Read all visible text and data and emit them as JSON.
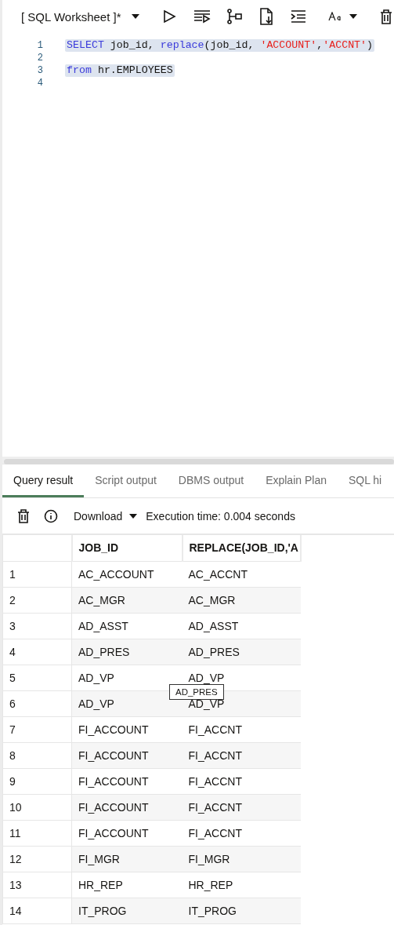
{
  "worksheet": {
    "title": "[ SQL Worksheet ]*"
  },
  "editor": {
    "lines": [
      {
        "number": "1",
        "highlighted": true,
        "tokens": [
          {
            "text": "SELECT",
            "kind": "keyword"
          },
          {
            "text": " job_id, ",
            "kind": "plain"
          },
          {
            "text": "replace",
            "kind": "keyword"
          },
          {
            "text": "(job_id, ",
            "kind": "plain"
          },
          {
            "text": "'ACCOUNT'",
            "kind": "string"
          },
          {
            "text": ",",
            "kind": "plain"
          },
          {
            "text": "'ACCNT'",
            "kind": "string"
          },
          {
            "text": ")",
            "kind": "plain"
          }
        ]
      },
      {
        "number": "2"
      },
      {
        "number": "3",
        "highlighted": true,
        "tokens": [
          {
            "text": "from",
            "kind": "keyword"
          },
          {
            "text": " hr.EMPLOYEES",
            "kind": "plain"
          }
        ]
      },
      {
        "number": "4"
      }
    ]
  },
  "tabs": [
    {
      "label": "Query result",
      "selected": true
    },
    {
      "label": "Script output",
      "selected": false
    },
    {
      "label": "DBMS output",
      "selected": false
    },
    {
      "label": "Explain Plan",
      "selected": false
    },
    {
      "label": "SQL hi",
      "selected": false
    }
  ],
  "result_toolbar": {
    "download": "Download",
    "execution_time": "Execution time: 0.004 seconds"
  },
  "table": {
    "columns": [
      "",
      "JOB_ID",
      "REPLACE(JOB_ID,'A"
    ],
    "rows": [
      [
        "1",
        "AC_ACCOUNT",
        "AC_ACCNT"
      ],
      [
        "2",
        "AC_MGR",
        "AC_MGR"
      ],
      [
        "3",
        "AD_ASST",
        "AD_ASST"
      ],
      [
        "4",
        "AD_PRES",
        "AD_PRES"
      ],
      [
        "5",
        "AD_VP",
        "AD_VP"
      ],
      [
        "6",
        "AD_VP",
        "AD_VP"
      ],
      [
        "7",
        "FI_ACCOUNT",
        "FI_ACCNT"
      ],
      [
        "8",
        "FI_ACCOUNT",
        "FI_ACCNT"
      ],
      [
        "9",
        "FI_ACCOUNT",
        "FI_ACCNT"
      ],
      [
        "10",
        "FI_ACCOUNT",
        "FI_ACCNT"
      ],
      [
        "11",
        "FI_ACCOUNT",
        "FI_ACCNT"
      ],
      [
        "12",
        "FI_MGR",
        "FI_MGR"
      ],
      [
        "13",
        "HR_REP",
        "HR_REP"
      ],
      [
        "14",
        "IT_PROG",
        "IT_PROG"
      ]
    ]
  },
  "tooltip": {
    "text": "AD_PRES"
  }
}
